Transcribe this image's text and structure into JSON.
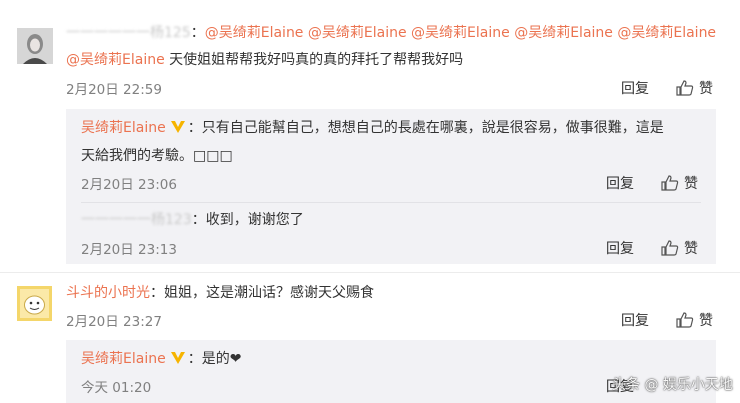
{
  "comment1": {
    "username_obscured": "一一一一一一杨125",
    "mentions": [
      "@吴绮莉Elaine",
      "@吴绮莉Elaine",
      "@吴绮莉Elaine",
      "@吴绮莉Elaine",
      "@吴绮莉Elaine",
      "@吴绮莉Elaine"
    ],
    "text": "天使姐姐帮帮我好吗真的真的拜托了帮帮我好吗",
    "time": "2月20日 22:59",
    "reply_label": "回复",
    "like_label": "赞",
    "replies": [
      {
        "username": "吴绮莉Elaine",
        "text_line1": "：只有自己能幫自己，想想自己的長處在哪裏，說是很容易，做事很難，這是",
        "text_line2": "天給我們的考驗。□□□",
        "time": "2月20日 23:06",
        "reply_label": "回复",
        "like_label": "赞"
      },
      {
        "username_obscured": "一一一一一杨123",
        "text": "：收到，谢谢您了",
        "time": "2月20日 23:13",
        "reply_label": "回复",
        "like_label": "赞"
      }
    ]
  },
  "comment2": {
    "username": "斗斗的小时光",
    "text": "：姐姐，这是潮汕话？感谢天父赐食",
    "time": "2月20日 23:27",
    "reply_label": "回复",
    "like_label": "赞",
    "replies": [
      {
        "username": "吴绮莉Elaine",
        "text": "：是的❤",
        "time": "今天 01:20",
        "reply_label": "回复"
      }
    ]
  },
  "watermark": "头条 @ 娱乐小天地",
  "colors": {
    "accent": "#eb7350",
    "verified": "#f6b400",
    "reply_bg": "#f2f2f5",
    "time": "#808080"
  }
}
